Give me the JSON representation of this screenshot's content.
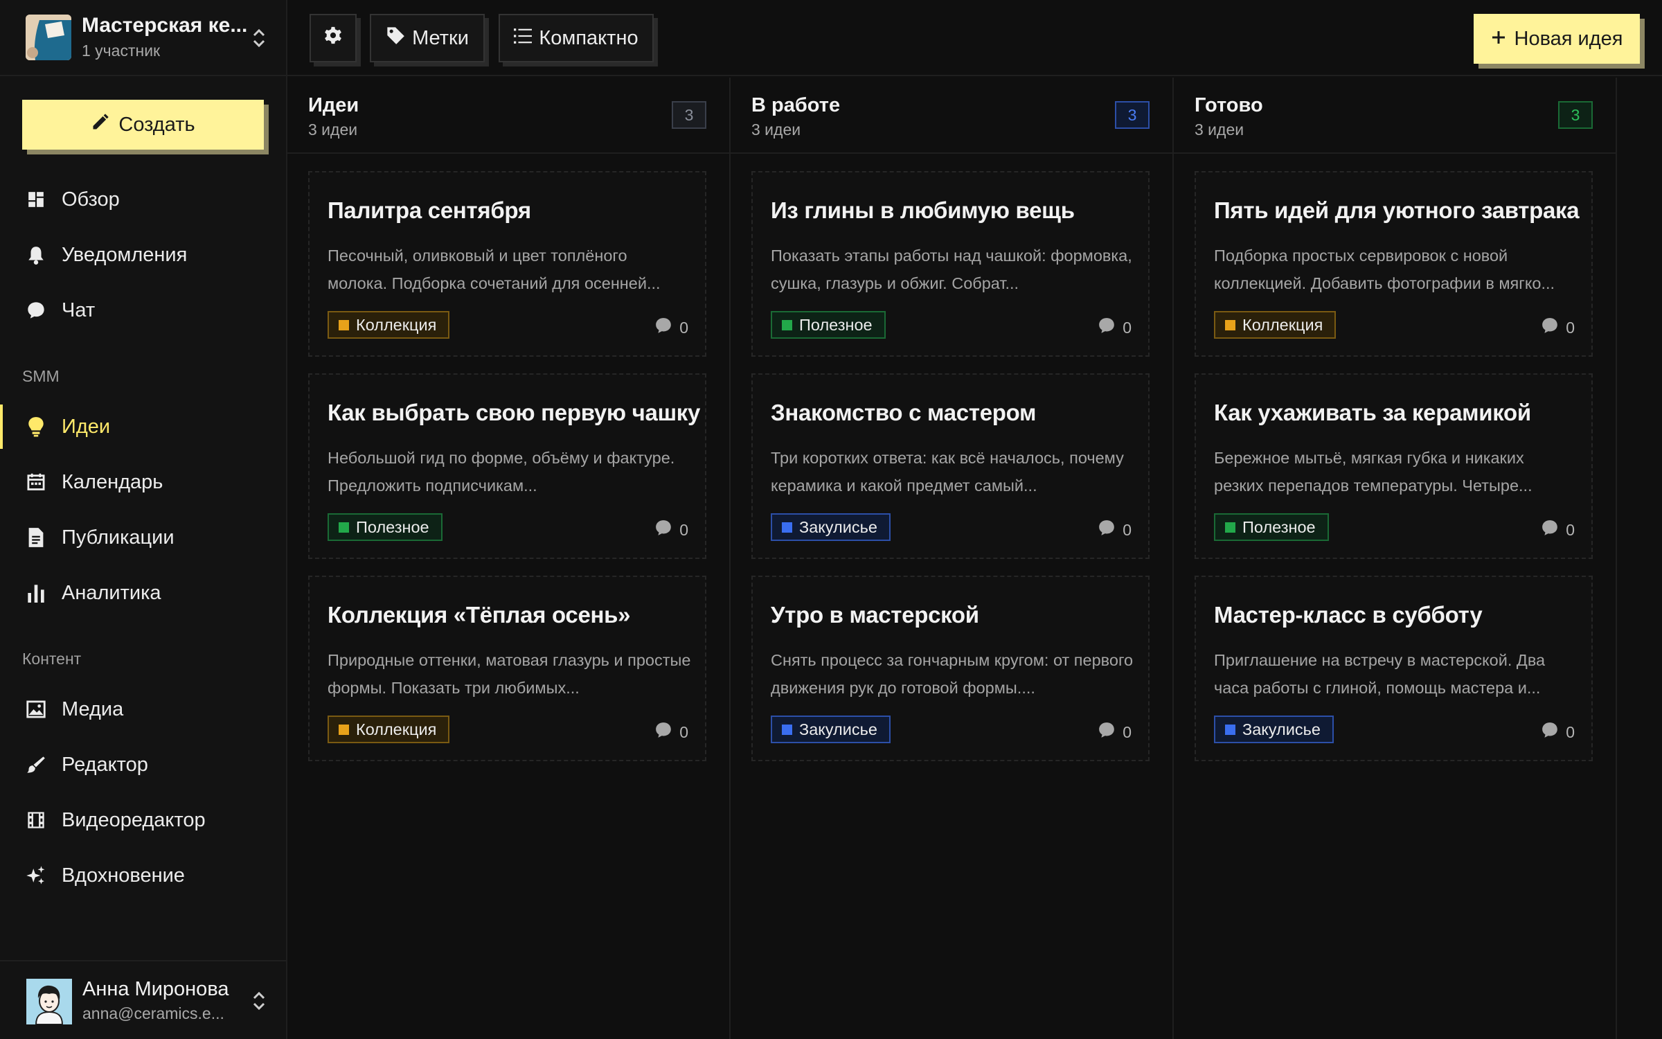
{
  "workspace": {
    "name": "Мастерская ке...",
    "members": "1 участник"
  },
  "sidebar": {
    "create_label": "Создать",
    "main": [
      {
        "label": "Обзор",
        "icon": "dashboard-icon"
      },
      {
        "label": "Уведомления",
        "icon": "bell-icon"
      },
      {
        "label": "Чат",
        "icon": "chat-icon"
      }
    ],
    "section_smm": "SMM",
    "smm": [
      {
        "label": "Идеи",
        "icon": "lightbulb-icon",
        "active": true
      },
      {
        "label": "Календарь",
        "icon": "calendar-icon"
      },
      {
        "label": "Публикации",
        "icon": "document-icon"
      },
      {
        "label": "Аналитика",
        "icon": "bar-chart-icon"
      }
    ],
    "section_content": "Контент",
    "content": [
      {
        "label": "Медиа",
        "icon": "image-icon"
      },
      {
        "label": "Редактор",
        "icon": "brush-icon"
      },
      {
        "label": "Видеоредактор",
        "icon": "film-icon"
      },
      {
        "label": "Вдохновение",
        "icon": "sparkles-icon"
      }
    ]
  },
  "user": {
    "name": "Анна Миронова",
    "email": "anna@ceramics.e..."
  },
  "toolbar": {
    "tags_label": "Метки",
    "compact_label": "Компактно",
    "new_idea_label": "Новая идея"
  },
  "tag_colors": {
    "Коллекция": "#e8a21a",
    "Полезное": "#22a84a",
    "Закулисье": "#3a6ef0"
  },
  "columns": [
    {
      "title": "Идеи",
      "subtitle": "3 идеи",
      "count": "3",
      "accent": "#3a3f4a",
      "cards": [
        {
          "title": "Палитра сентября",
          "desc": "Песочный, оливковый и цвет топлёного молока. Подборка сочетаний для осенней...",
          "tag": "Коллекция",
          "comments": "0"
        },
        {
          "title": "Как выбрать свою первую чашку",
          "desc": "Небольшой гид по форме, объёму и фактуре. Предложить подписчикам...",
          "tag": "Полезное",
          "comments": "0"
        },
        {
          "title": "Коллекция «Тёплая осень»",
          "desc": "Природные оттенки, матовая глазурь и простые формы. Показать три любимых...",
          "tag": "Коллекция",
          "comments": "0"
        }
      ]
    },
    {
      "title": "В работе",
      "subtitle": "3 идеи",
      "count": "3",
      "accent": "#3a6ef0",
      "cards": [
        {
          "title": "Из глины в любимую вещь",
          "desc": "Показать этапы работы над чашкой: формовка, сушка, глазурь и обжиг. Собрат...",
          "tag": "Полезное",
          "comments": "0"
        },
        {
          "title": "Знакомство с мастером",
          "desc": "Три коротких ответа: как всё началось, почему керамика и какой предмет самый...",
          "tag": "Закулисье",
          "comments": "0"
        },
        {
          "title": "Утро в мастерской",
          "desc": "Снять процесс за гончарным кругом: от первого движения рук до готовой формы....",
          "tag": "Закулисье",
          "comments": "0"
        }
      ]
    },
    {
      "title": "Готово",
      "subtitle": "3 идеи",
      "count": "3",
      "accent": "#22a84a",
      "cards": [
        {
          "title": "Пять идей для уютного завтрака",
          "desc": "Подборка простых сервировок с новой коллекцией. Добавить фотографии в мягко...",
          "tag": "Коллекция",
          "comments": "0"
        },
        {
          "title": "Как ухаживать за керамикой",
          "desc": "Бережное мытьё, мягкая губка и никаких резких перепадов температуры. Четыре...",
          "tag": "Полезное",
          "comments": "0"
        },
        {
          "title": "Мастер-класс в субботу",
          "desc": "Приглашение на встречу в мастерской. Два часа работы с глиной, помощь мастера и...",
          "tag": "Закулисье",
          "comments": "0"
        }
      ]
    }
  ]
}
